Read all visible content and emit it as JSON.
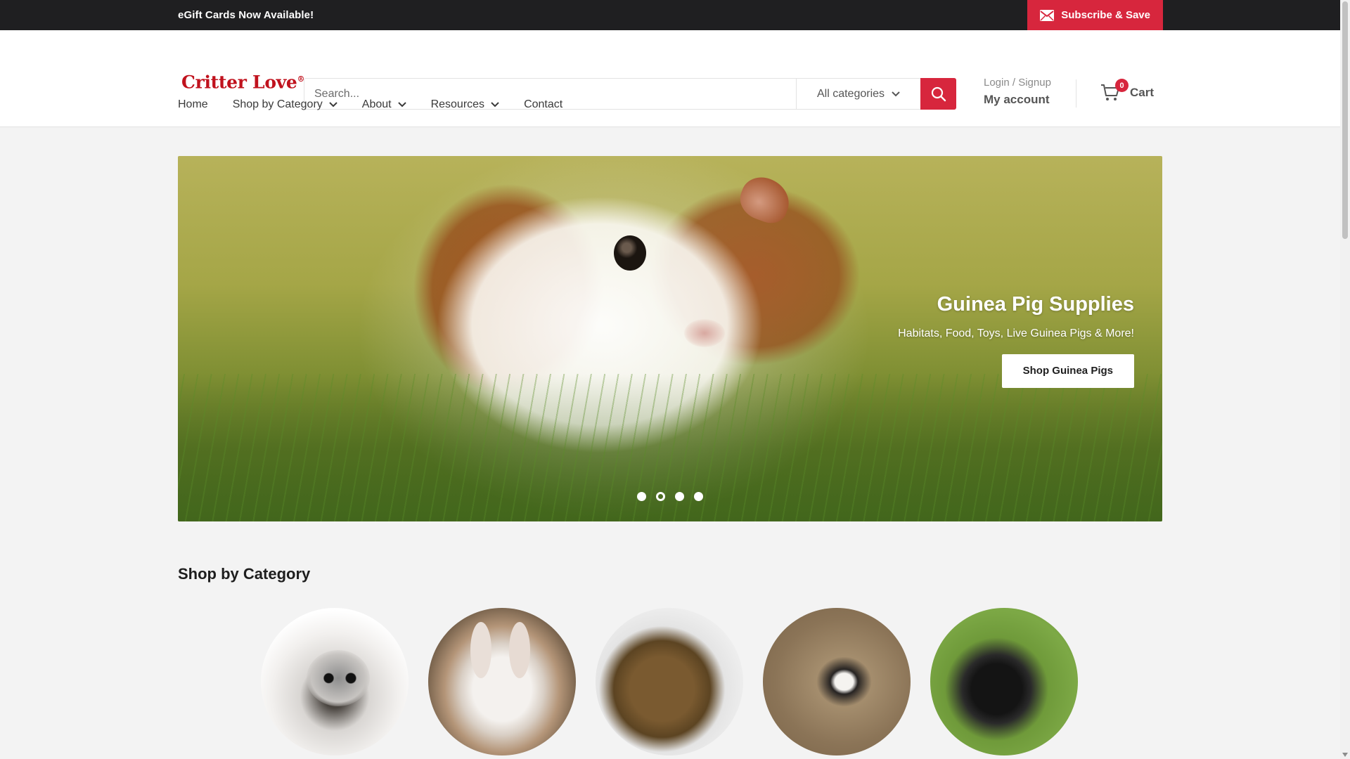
{
  "announcement": {
    "message": "eGift Cards Now Available!",
    "subscribe_label": "Subscribe & Save",
    "subscribe_icon": "envelope-icon"
  },
  "header": {
    "logo_text": "Critter Love",
    "logo_mark": "®",
    "search": {
      "placeholder": "Search...",
      "value": "",
      "category_label": "All categories",
      "button_icon": "search-icon"
    },
    "account": {
      "login_label": "Login / Signup",
      "account_label": "My account"
    },
    "cart": {
      "count": "0",
      "label": "Cart",
      "icon": "cart-icon"
    }
  },
  "nav": {
    "items": [
      {
        "label": "Home",
        "has_dropdown": false
      },
      {
        "label": "Shop by Category",
        "has_dropdown": true
      },
      {
        "label": "About",
        "has_dropdown": true
      },
      {
        "label": "Resources",
        "has_dropdown": true
      },
      {
        "label": "Contact",
        "has_dropdown": false
      }
    ]
  },
  "hero": {
    "title": "Guinea Pig Supplies",
    "subtitle": "Habitats, Food, Toys, Live Guinea Pigs & More!",
    "button_label": "Shop Guinea Pigs",
    "slide_count": 4,
    "active_slide": 2
  },
  "categories": {
    "title": "Shop by Category",
    "items": [
      {
        "image": "sugar-glider-photo"
      },
      {
        "image": "rabbit-photo"
      },
      {
        "image": "guinea-pig-photo"
      },
      {
        "image": "goat-kid-photo"
      },
      {
        "image": "black-goat-photo"
      }
    ]
  },
  "colors": {
    "brand_red": "#d7263d",
    "logo_red": "#c0121d",
    "announcement_bg": "#1f1f21",
    "page_bg": "#f3f3f3"
  }
}
